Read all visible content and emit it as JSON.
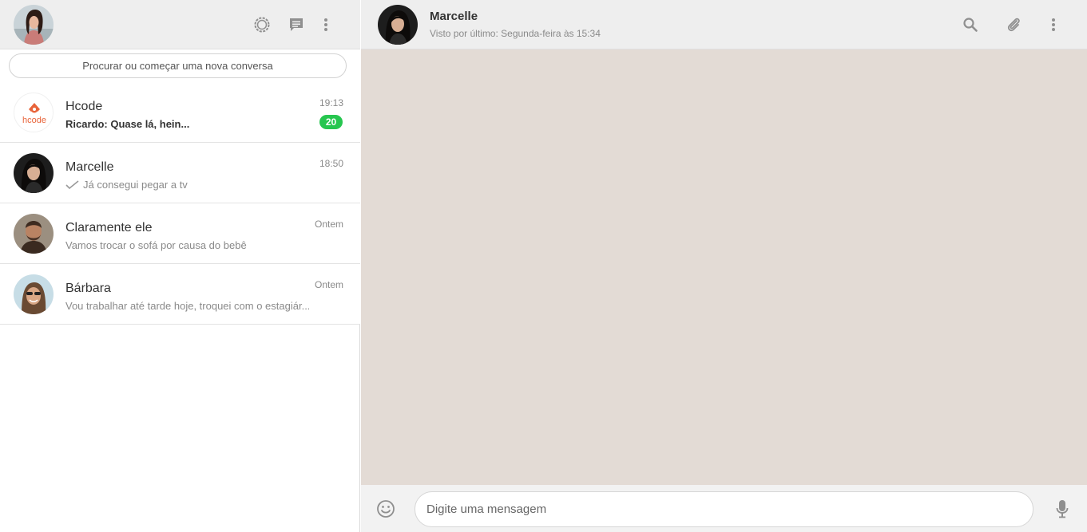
{
  "sidebar": {
    "header": {
      "my_avatar_icon": "user-avatar-photo",
      "status_icon": "status-ring-icon",
      "new_chat_icon": "chat-bubble-icon",
      "menu_icon": "vertical-dots-icon"
    },
    "search": {
      "placeholder": "Procurar ou começar uma nova conversa"
    },
    "chats": [
      {
        "name": "Hcode",
        "time": "19:13",
        "preview": "Ricardo: Quase lá, hein...",
        "preview_bold": true,
        "unread": "20",
        "avatar_icon": "hcode-logo",
        "logo_text": "hcode"
      },
      {
        "name": "Marcelle",
        "time": "18:50",
        "preview": "Já consegui pegar a tv",
        "delivered_icon": "check-icon",
        "avatar_icon": "contact-photo"
      },
      {
        "name": "Claramente ele",
        "time": "Ontem",
        "preview": "Vamos trocar o sofá por causa do bebê",
        "avatar_icon": "contact-photo"
      },
      {
        "name": "Bárbara",
        "time": "Ontem",
        "preview": "Vou trabalhar até tarde hoje, troquei com o estagiár...",
        "avatar_icon": "contact-photo"
      }
    ]
  },
  "conversation": {
    "header": {
      "contact_name": "Marcelle",
      "contact_status": "Visto por último: Segunda-feira às 15:34",
      "search_icon": "search-icon",
      "attach_icon": "paperclip-icon",
      "menu_icon": "vertical-dots-icon"
    },
    "composer": {
      "placeholder": "Digite uma mensagem",
      "emoji_icon": "smiley-icon",
      "mic_icon": "microphone-icon"
    }
  },
  "colors": {
    "header_bg": "#eeeeee",
    "chat_bg": "#e3dbd5",
    "unread_badge": "#26c64f",
    "icon_gray": "#8f8f8f"
  }
}
